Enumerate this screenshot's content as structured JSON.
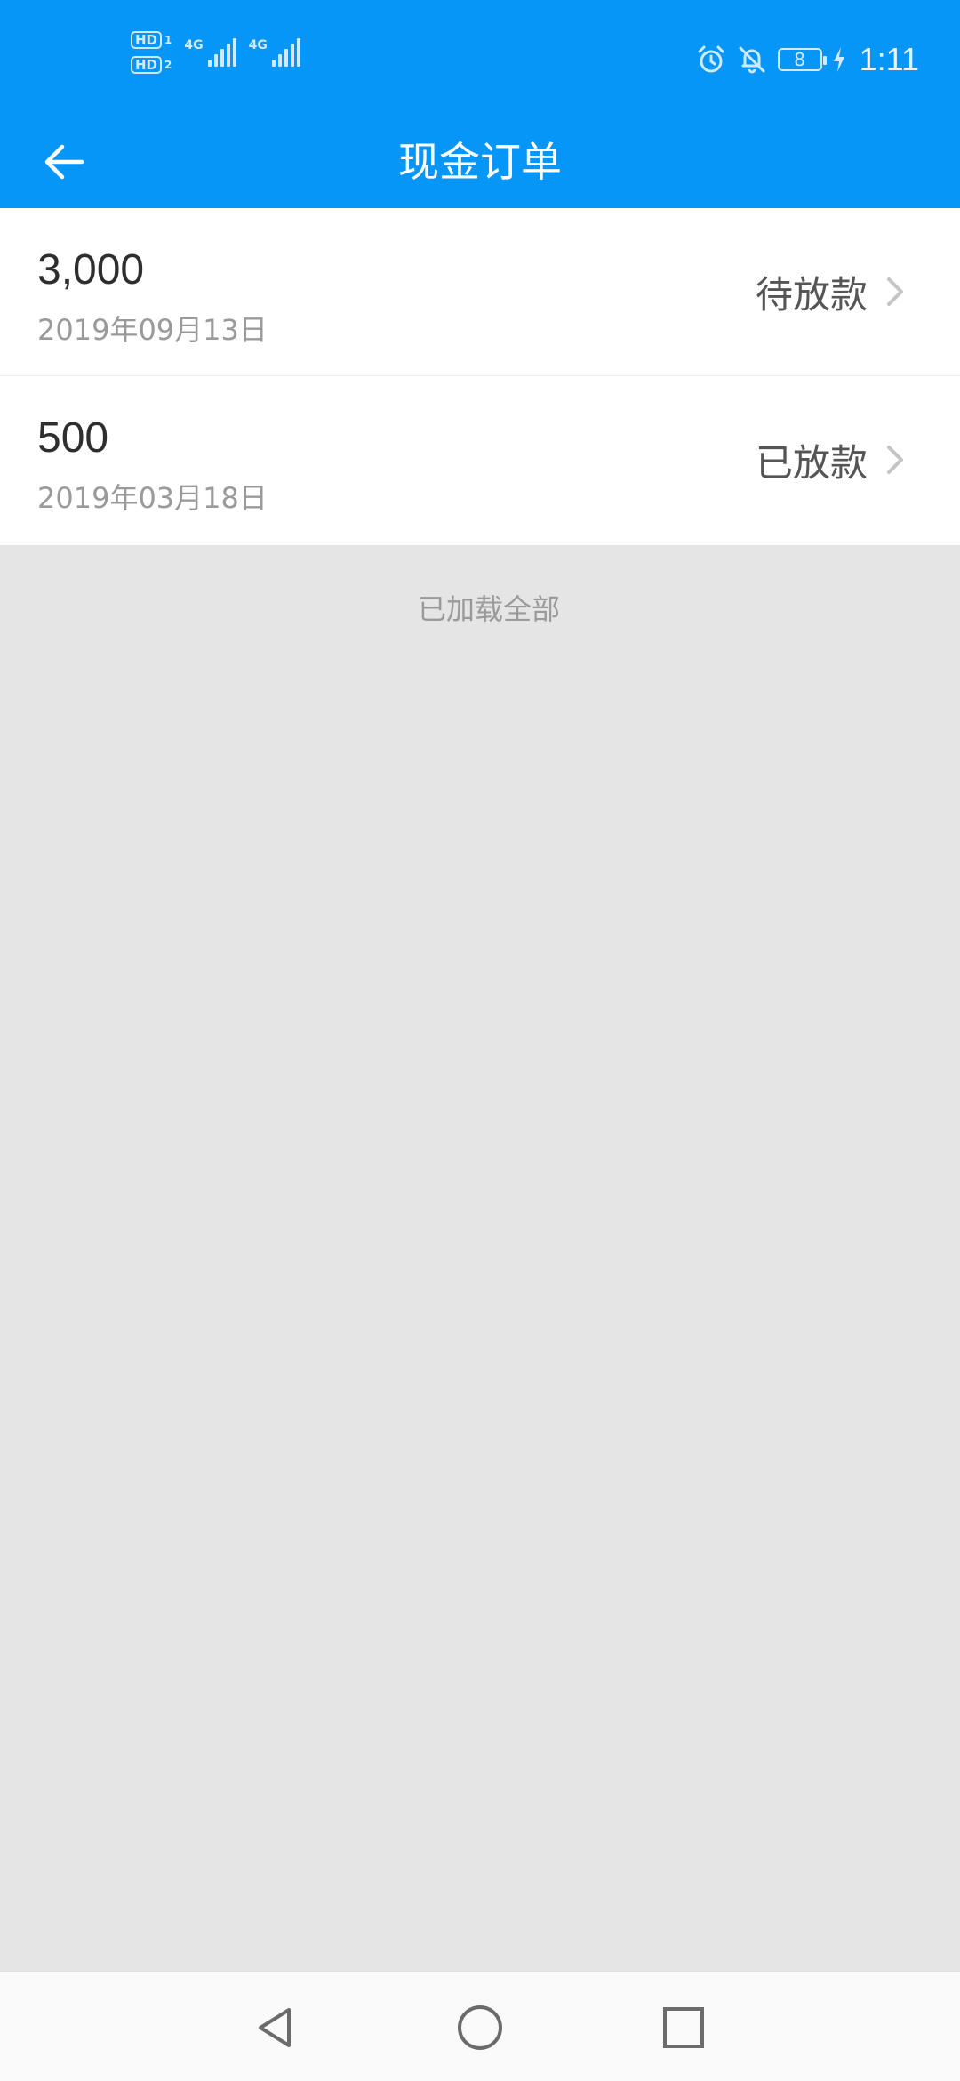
{
  "status_bar": {
    "sim1_label": "HD",
    "sim1_num": "1",
    "sim2_label": "HD",
    "sim2_num": "2",
    "network1": "4G",
    "network2": "4G",
    "battery": "8",
    "time": "1:11",
    "icons": [
      "alarm-icon",
      "bell-off-icon",
      "battery-icon",
      "charging-icon"
    ]
  },
  "header": {
    "title": "现金订单",
    "back_icon": "arrow-left-icon"
  },
  "orders": [
    {
      "amount": "3,000",
      "date": "2019年09月13日",
      "status": "待放款"
    },
    {
      "amount": "500",
      "date": "2019年03月18日",
      "status": "已放款"
    }
  ],
  "footer_text": "已加载全部",
  "nav_bar": {
    "icons": [
      "back-triangle-icon",
      "home-circle-icon",
      "recents-square-icon"
    ]
  },
  "colors": {
    "primary": "#0596f7",
    "background": "#e5e5e5"
  }
}
